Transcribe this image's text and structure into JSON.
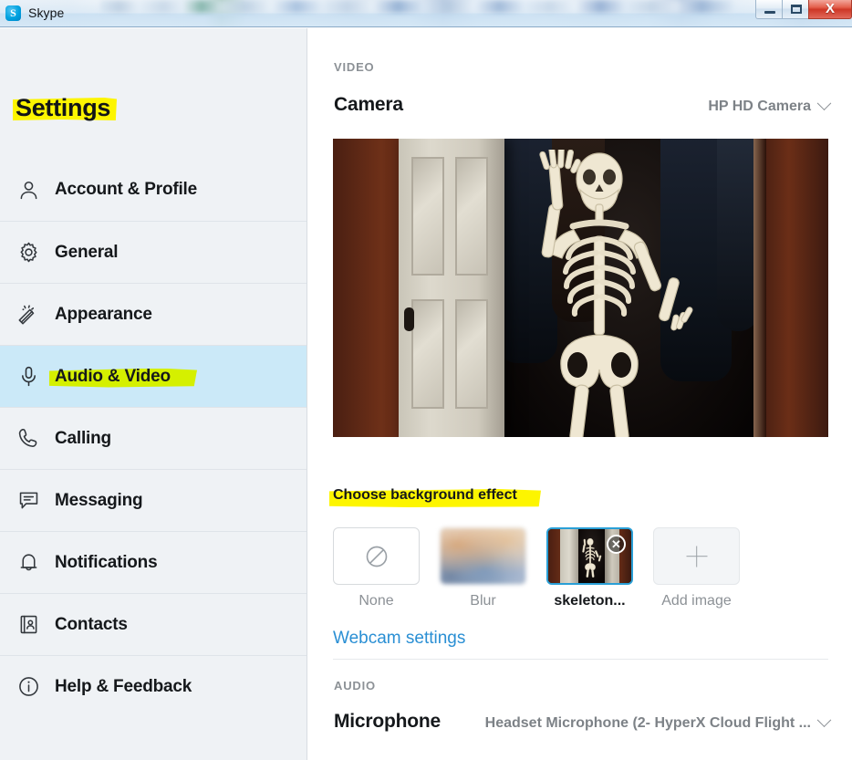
{
  "window": {
    "app_title": "Skype",
    "app_icon": "skype-logo-icon",
    "minimize_label": "—",
    "maximize_label": "❐",
    "close_label": "X"
  },
  "sidebar": {
    "title": "Settings",
    "items": [
      {
        "label": "Account & Profile",
        "icon": "person-icon",
        "selected": false
      },
      {
        "label": "General",
        "icon": "gear-icon",
        "selected": false
      },
      {
        "label": "Appearance",
        "icon": "magic-wand-icon",
        "selected": false
      },
      {
        "label": "Audio & Video",
        "icon": "microphone-icon",
        "selected": true
      },
      {
        "label": "Calling",
        "icon": "phone-icon",
        "selected": false
      },
      {
        "label": "Messaging",
        "icon": "chat-bubble-icon",
        "selected": false
      },
      {
        "label": "Notifications",
        "icon": "bell-icon",
        "selected": false
      },
      {
        "label": "Contacts",
        "icon": "address-book-icon",
        "selected": false
      },
      {
        "label": "Help & Feedback",
        "icon": "info-circle-icon",
        "selected": false
      }
    ]
  },
  "main": {
    "video_section_label": "VIDEO",
    "camera_row_title": "Camera",
    "camera_device": "HP HD Camera",
    "camera_dropdown_icon": "chevron-down-icon",
    "background_effect_caption": "Choose background effect",
    "background_effects": [
      {
        "label": "None",
        "type": "none",
        "selected": false,
        "icon": "no-entry-icon"
      },
      {
        "label": "Blur",
        "type": "blur",
        "selected": false
      },
      {
        "label": "skeleton...",
        "type": "image",
        "selected": true,
        "remove_icon": "close-circle-icon",
        "remove_label": "✕"
      },
      {
        "label": "Add image",
        "type": "add",
        "selected": false,
        "icon": "plus-icon"
      }
    ],
    "webcam_settings_link": "Webcam settings",
    "audio_section_label": "AUDIO",
    "microphone_row_title": "Microphone",
    "microphone_device": "Headset Microphone (2- HyperX Cloud Flight ...",
    "microphone_dropdown_icon": "chevron-down-icon"
  },
  "colors": {
    "sidebar_bg": "#eff2f5",
    "selected_item_bg": "#cbe9f8",
    "highlight_yellow": "#fdf500",
    "highlight_green": "#d5f000",
    "link_blue": "#2a8fd4",
    "thumb_selected_border": "#2a9fd6",
    "muted_text": "#8c9196"
  }
}
